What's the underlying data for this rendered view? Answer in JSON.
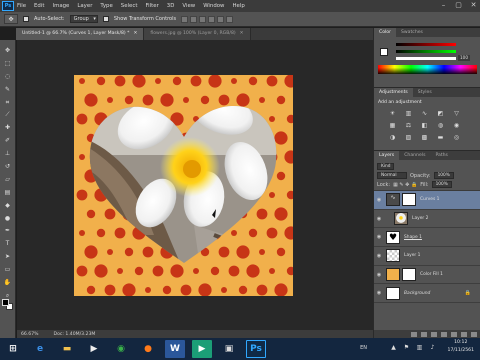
{
  "menubar": {
    "logo": "Ps",
    "items": [
      "File",
      "Edit",
      "Image",
      "Layer",
      "Type",
      "Select",
      "Filter",
      "3D",
      "View",
      "Window",
      "Help"
    ],
    "controls": [
      "–",
      "▢",
      "✕"
    ]
  },
  "options": {
    "auto_select_label": "Auto-Select:",
    "group_value": "Group",
    "transform_label": "Show Transform Controls"
  },
  "tabs": [
    {
      "label": "Untitled-1 @ 66.7% (Curves 1, Layer Mask/8) *",
      "active": true
    },
    {
      "label": "flowers.jpg @ 100% (Layer 0, RGB/8)",
      "active": false
    }
  ],
  "status": {
    "zoom": "66.67%",
    "doc": "Doc: 1.40M/3.23M"
  },
  "panels": {
    "color_tabs": [
      "Color",
      "Swatches"
    ],
    "slider_value": "100",
    "adj_tabs": [
      "Adjustments",
      "Styles"
    ],
    "adj_header": "Add an adjustment",
    "layers_tabs": [
      "Layers",
      "Channels",
      "Paths"
    ],
    "kind_label": "Kind",
    "blend_mode": "Normal",
    "opacity_label": "Opacity:",
    "opacity_value": "100%",
    "lock_label": "Lock:",
    "fill_label": "Fill:",
    "fill_value": "100%"
  },
  "layers": [
    {
      "name": "Curves 1",
      "active": true
    },
    {
      "name": "Layer 2",
      "active": false
    },
    {
      "name": "Shape 1",
      "active": false
    },
    {
      "name": "Layer 1",
      "active": false
    },
    {
      "name": "Color Fill 1",
      "active": false
    },
    {
      "name": "Background",
      "active": false
    }
  ],
  "taskbar": {
    "time": "10:12",
    "date": "17/11/2561",
    "language": "EN"
  },
  "colors": {
    "canvas_bg": "#f1b04b",
    "dots": "#c73516",
    "accent": "#31a8ff"
  }
}
